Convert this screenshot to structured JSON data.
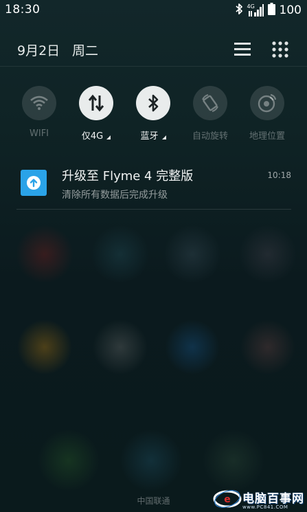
{
  "status_bar": {
    "time": "18:30",
    "network_type": "4G",
    "battery": "100"
  },
  "header": {
    "date": "9月2日",
    "weekday": "周二"
  },
  "toggles": [
    {
      "label": "WIFI",
      "state": "off",
      "icon": "wifi-icon"
    },
    {
      "label": "仅4G",
      "state": "on",
      "icon": "mobile-data-icon"
    },
    {
      "label": "蓝牙",
      "state": "on",
      "icon": "bluetooth-icon"
    },
    {
      "label": "自动旋转",
      "state": "off",
      "icon": "auto-rotate-icon"
    },
    {
      "label": "地理位置",
      "state": "off",
      "icon": "location-icon"
    }
  ],
  "notification": {
    "icon": "upgrade-arrow-icon",
    "title": "升级至 Flyme 4 完整版",
    "subtitle": "清除所有数据后完成升级",
    "time": "10:18"
  },
  "carrier": "中国联通",
  "watermark": {
    "text": "电脑百事网",
    "url": "www.PC841.COM"
  },
  "colors": {
    "toggle_on": "#e9ecec",
    "toggle_off": "rgba(255,255,255,0.12)",
    "notification_icon_bg": "#2aa3e8"
  }
}
